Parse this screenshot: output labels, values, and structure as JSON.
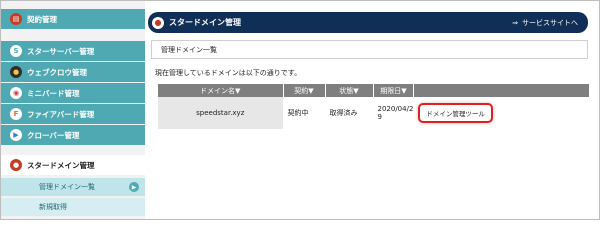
{
  "sidebar": {
    "header": "契約管理",
    "items": [
      {
        "label": "スターサーバー管理",
        "icon": "s-icon"
      },
      {
        "label": "ウェブクロウ管理",
        "icon": "crow-icon"
      },
      {
        "label": "ミニバード管理",
        "icon": "bird-icon"
      },
      {
        "label": "ファイアバード管理",
        "icon": "firebird-icon"
      },
      {
        "label": "クローバー管理",
        "icon": "clover-icon"
      }
    ],
    "active_section": "スタードメイン管理",
    "sub_items": [
      "管理ドメイン一覧",
      "新規取得"
    ]
  },
  "topbar": {
    "title": "スタードメイン管理",
    "service_link": "サービスサイトへ",
    "service_arrow": "⇒"
  },
  "section": {
    "heading": "管理ドメイン一覧",
    "description": "現在管理しているドメインは以下の通りです。"
  },
  "table": {
    "headers": [
      "ドメイン名▼",
      "契約▼",
      "状態▼",
      "期限日▼"
    ],
    "rows": [
      {
        "domain": "speedstar.xyz",
        "contract": "契約中",
        "status": "取得済み",
        "expiry_line1": "2020/04/2",
        "expiry_line2": "9",
        "action": "ドメイン管理ツール"
      }
    ]
  },
  "colors": {
    "teal": "#4fa9b3",
    "navy": "#102f56",
    "highlight": "#e02020"
  }
}
